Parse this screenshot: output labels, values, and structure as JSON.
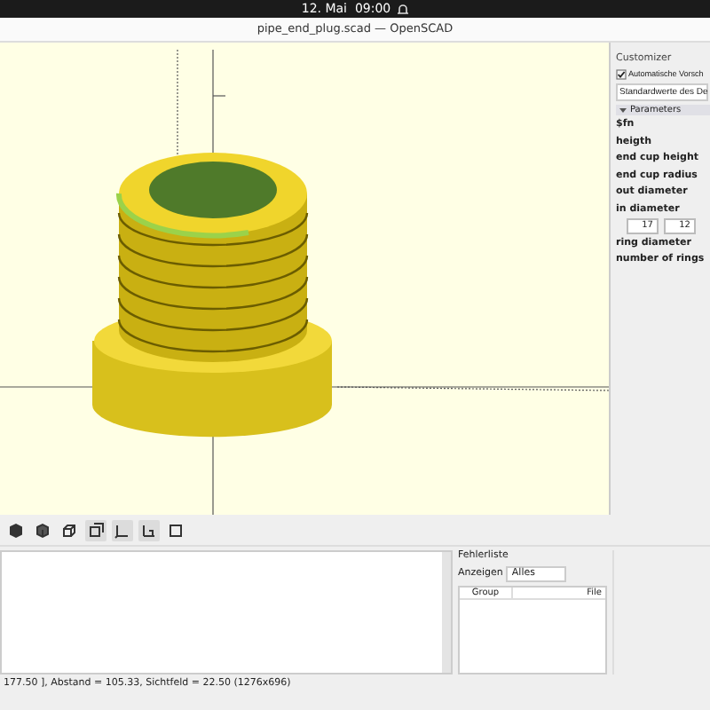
{
  "top_bar": {
    "clock": "12. Mai  09:00"
  },
  "window": {
    "title": "pipe_end_plug.scad — OpenSCAD"
  },
  "customizer": {
    "title": "Customizer",
    "auto_preview": {
      "label": "Automatische Vorsch",
      "checked": true
    },
    "preset": "Standardwerte des De",
    "group": {
      "label": "Parameters",
      "expanded": true
    },
    "parameters": [
      {
        "kind": "label",
        "label": "$fn"
      },
      {
        "kind": "label",
        "label": "heigth"
      },
      {
        "kind": "label",
        "label": "end cup height"
      },
      {
        "kind": "label",
        "label": "end cup radius"
      },
      {
        "kind": "label",
        "label": "out diameter"
      },
      {
        "kind": "label",
        "label": "in diameter"
      },
      {
        "kind": "spinners",
        "values": [
          "17",
          "12"
        ]
      },
      {
        "kind": "label",
        "label": "ring diameter"
      },
      {
        "kind": "label",
        "label": "number of rings"
      }
    ]
  },
  "toolbar": [
    {
      "pressed": false
    },
    {
      "pressed": false
    },
    {
      "pressed": false
    },
    {
      "pressed": true
    },
    {
      "pressed": true
    },
    {
      "pressed": true
    },
    {
      "pressed": false
    }
  ],
  "error_list": {
    "title": "Fehlerliste",
    "filter_label": "Anzeigen",
    "filter_value": "Alles",
    "columns": [
      "Group",
      "File"
    ]
  },
  "status_bar": {
    "text": "177.50 ], Abstand = 105.33, Sichtfeld = 22.50 (1276x696)"
  }
}
